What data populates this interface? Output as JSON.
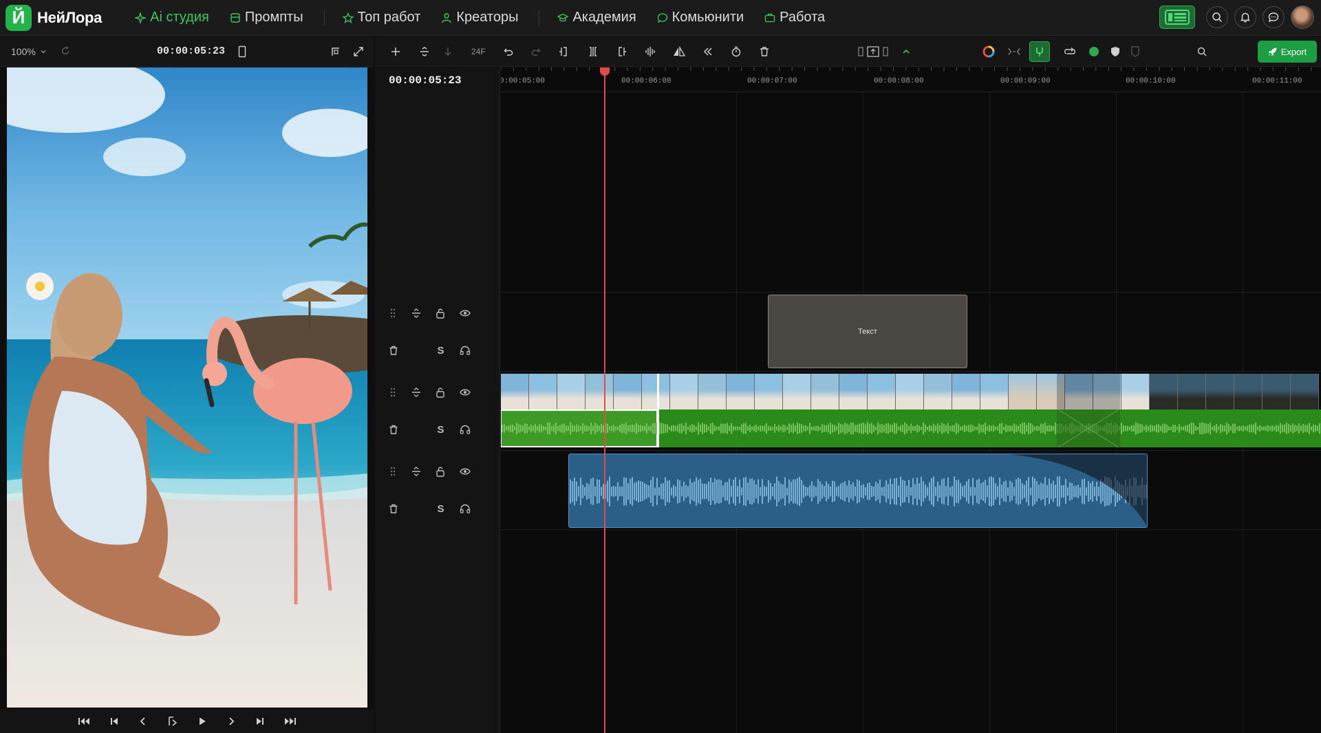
{
  "brand": {
    "name": "НейЛора",
    "badge": "Й",
    "accent": "#22b34a"
  },
  "nav": {
    "items": [
      {
        "label": "Ai студия",
        "icon": "sparkle-icon",
        "active": true
      },
      {
        "label": "Промпты",
        "icon": "table-icon",
        "active": false
      },
      {
        "label": "Топ работ",
        "icon": "star-icon",
        "active": false
      },
      {
        "label": "Креаторы",
        "icon": "user-icon",
        "active": false
      },
      {
        "label": "Академия",
        "icon": "graduation-cap-icon",
        "active": false
      },
      {
        "label": "Комьюнити",
        "icon": "chat-bubble-icon",
        "active": false
      },
      {
        "label": "Работа",
        "icon": "briefcase-icon",
        "active": false
      }
    ]
  },
  "preview": {
    "zoom": "100%",
    "timecode": "00:00:05:23"
  },
  "toolbar": {
    "fps": "24F",
    "export_label": "Export"
  },
  "timeline": {
    "current_time": "00:00:05:23",
    "ruler_labels": [
      "0:00:05:00",
      "00:00:06:00",
      "00:00:07:00",
      "00:00:08:00",
      "00:00:09:00",
      "00:00:10:00",
      "00:00:11:00"
    ],
    "text_clip_label": "Текст",
    "solo_label": "S"
  }
}
